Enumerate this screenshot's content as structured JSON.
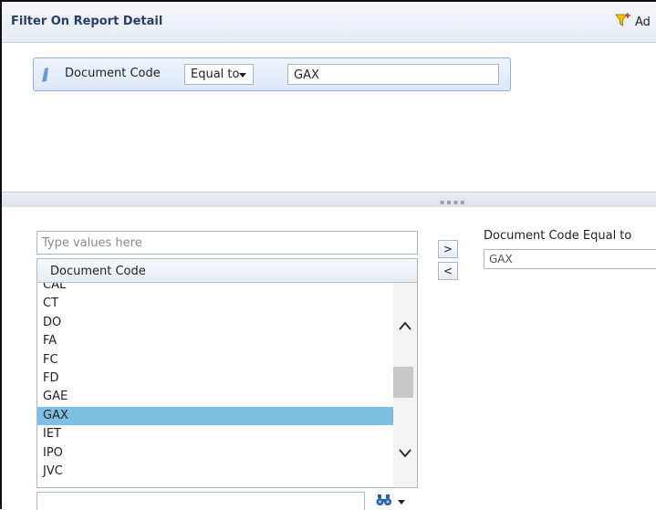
{
  "header": {
    "title": "Filter On Report Detail",
    "add_label": "Ad"
  },
  "condition": {
    "object": "Document Code",
    "operator": "Equal to",
    "value": "GAX"
  },
  "value_picker": {
    "search_placeholder": "Type values here",
    "column_header": "Document Code",
    "items": [
      {
        "label": "CAL",
        "selected": false
      },
      {
        "label": "CT",
        "selected": false
      },
      {
        "label": "DO",
        "selected": false
      },
      {
        "label": "FA",
        "selected": false
      },
      {
        "label": "FC",
        "selected": false
      },
      {
        "label": "FD",
        "selected": false
      },
      {
        "label": "GAE",
        "selected": false
      },
      {
        "label": "GAX",
        "selected": true
      },
      {
        "label": "IET",
        "selected": false
      },
      {
        "label": "IPO",
        "selected": false
      },
      {
        "label": "JVC",
        "selected": false
      }
    ],
    "add_button": ">",
    "remove_button": "<"
  },
  "result": {
    "label": "Document Code Equal to",
    "value": "GAX"
  },
  "colors": {
    "selected_row": "#7fbfe4",
    "header_text": "#2a3f66",
    "funnel": "#f2c200"
  }
}
